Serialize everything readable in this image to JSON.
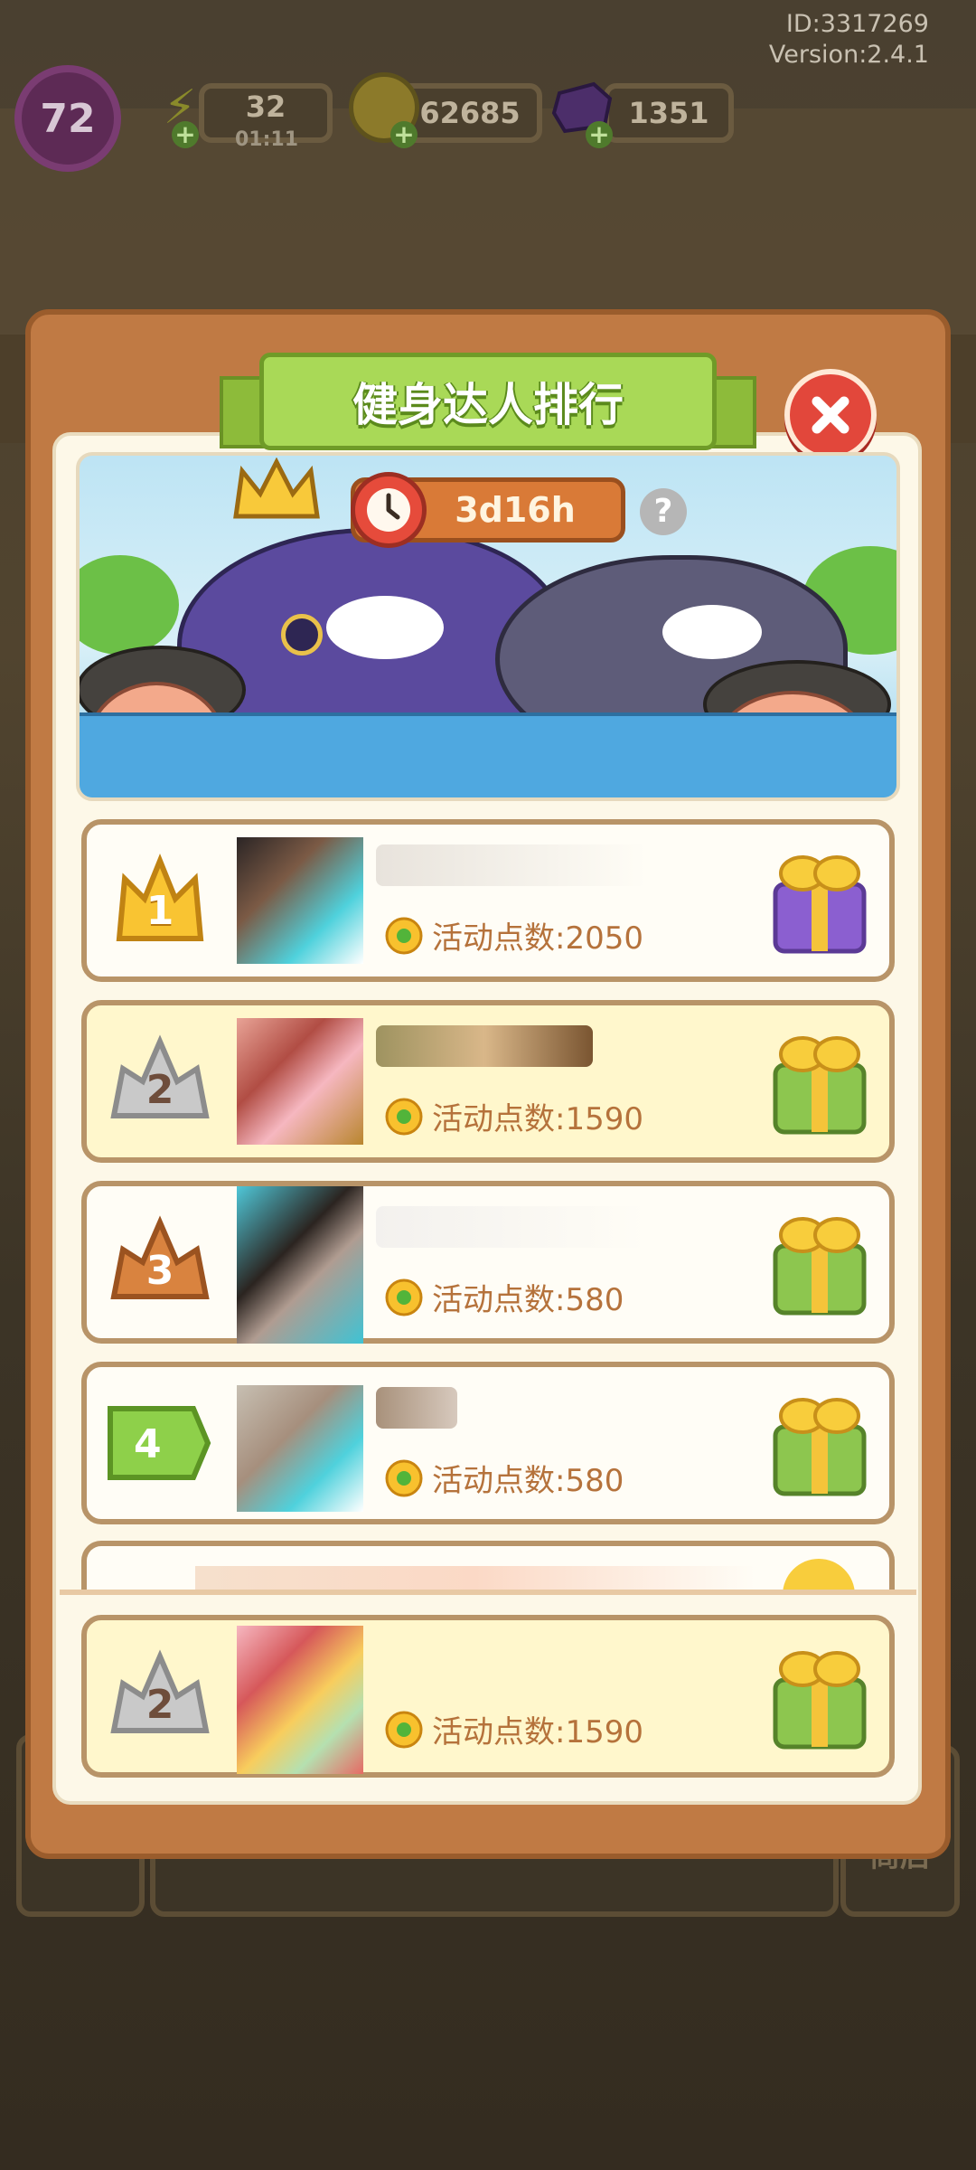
{
  "header": {
    "id_label": "ID:3317269",
    "version_label": "Version:2.4.1"
  },
  "status_bar": {
    "level": "72",
    "energy": {
      "value": "32",
      "timer": "01:11",
      "icon": "lightning-icon"
    },
    "coins": {
      "value": "62685",
      "icon": "coin-icon"
    },
    "gems": {
      "value": "1351",
      "icon": "gem-icon"
    }
  },
  "modal": {
    "title": "健身达人排行",
    "countdown": "3d16h",
    "help_glyph": "?",
    "close_icon": "close-icon"
  },
  "leaderboard": [
    {
      "rank": "1",
      "points_label": "活动点数:2050",
      "badge": "gold-crown",
      "gift": "purple-gift"
    },
    {
      "rank": "2",
      "points_label": "活动点数:1590",
      "badge": "silver-crown",
      "gift": "green-gift"
    },
    {
      "rank": "3",
      "points_label": "活动点数:580",
      "badge": "bronze-crown",
      "gift": "green-gift"
    },
    {
      "rank": "4",
      "points_label": "活动点数:580",
      "badge": "green-flag",
      "gift": "green-gift"
    }
  ],
  "my_rank": {
    "rank": "2",
    "points_label": "活动点数:1590",
    "badge": "silver-crown",
    "gift": "green-gift"
  },
  "bottom_bar": {
    "shop_label": "商店"
  },
  "colors": {
    "modal_frame": "#c07a44",
    "title_green": "#a9d957",
    "close_red": "#e2473b",
    "points_text": "#b5723b",
    "row_highlight": "#fff7cc"
  }
}
